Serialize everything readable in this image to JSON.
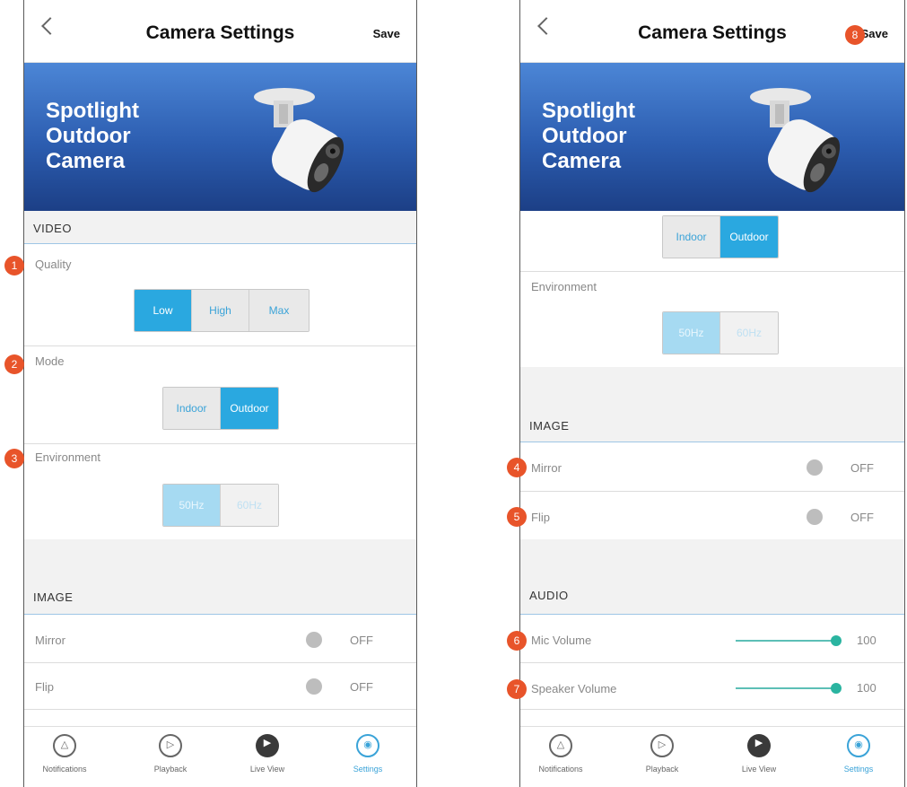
{
  "header": {
    "title": "Camera Settings",
    "save_label": "Save"
  },
  "banner": {
    "line1": "Spotlight",
    "line2": "Outdoor",
    "line3": "Camera"
  },
  "sections": {
    "video": "VIDEO",
    "image": "IMAGE",
    "audio": "AUDIO"
  },
  "video": {
    "quality_label": "Quality",
    "quality_options": [
      "Low",
      "High",
      "Max"
    ],
    "quality_selected": "Low",
    "mode_label": "Mode",
    "mode_options": [
      "Indoor",
      "Outdoor"
    ],
    "mode_selected": "Outdoor",
    "environment_label": "Environment",
    "environment_options": [
      "50Hz",
      "60Hz"
    ],
    "environment_selected": "50Hz"
  },
  "image": {
    "mirror_label": "Mirror",
    "mirror_state": "OFF",
    "flip_label": "Flip",
    "flip_state": "OFF"
  },
  "audio": {
    "mic_label": "Mic Volume",
    "mic_value": "100",
    "speaker_label": "Speaker Volume",
    "speaker_value": "100"
  },
  "nav": {
    "items": [
      {
        "label": "Notifications",
        "icon": "bell-icon"
      },
      {
        "label": "Playback",
        "icon": "playback-icon"
      },
      {
        "label": "Live View",
        "icon": "live-view-icon"
      },
      {
        "label": "Settings",
        "icon": "settings-icon"
      }
    ],
    "active": "Settings"
  },
  "badges": [
    "1",
    "2",
    "3",
    "4",
    "5",
    "6",
    "7",
    "8"
  ],
  "colors": {
    "accent": "#2aa8e0",
    "badge": "#e8542a",
    "banner": "#2c5db0",
    "slider": "#2ab4a0"
  }
}
